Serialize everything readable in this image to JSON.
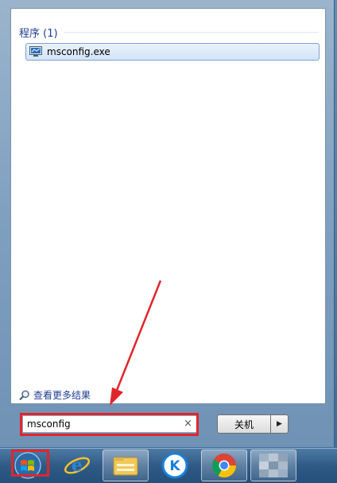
{
  "results": {
    "group_title": "程序 (1)",
    "items": [
      {
        "label": "msconfig.exe",
        "icon": "system-config-icon"
      }
    ],
    "see_more_label": "查看更多结果"
  },
  "search": {
    "value": "msconfig",
    "clear_glyph": "×"
  },
  "power": {
    "shutdown_label": "关机",
    "arrow_glyph": "▶"
  },
  "taskbar": {
    "items": [
      {
        "name": "internet-explorer-icon"
      },
      {
        "name": "file-explorer-icon"
      },
      {
        "name": "kugou-music-icon"
      },
      {
        "name": "chrome-browser-icon"
      },
      {
        "name": "blurred-app-icon"
      }
    ]
  },
  "colors": {
    "annotation": "#e0262b",
    "link_blue": "#1e3d8f"
  }
}
